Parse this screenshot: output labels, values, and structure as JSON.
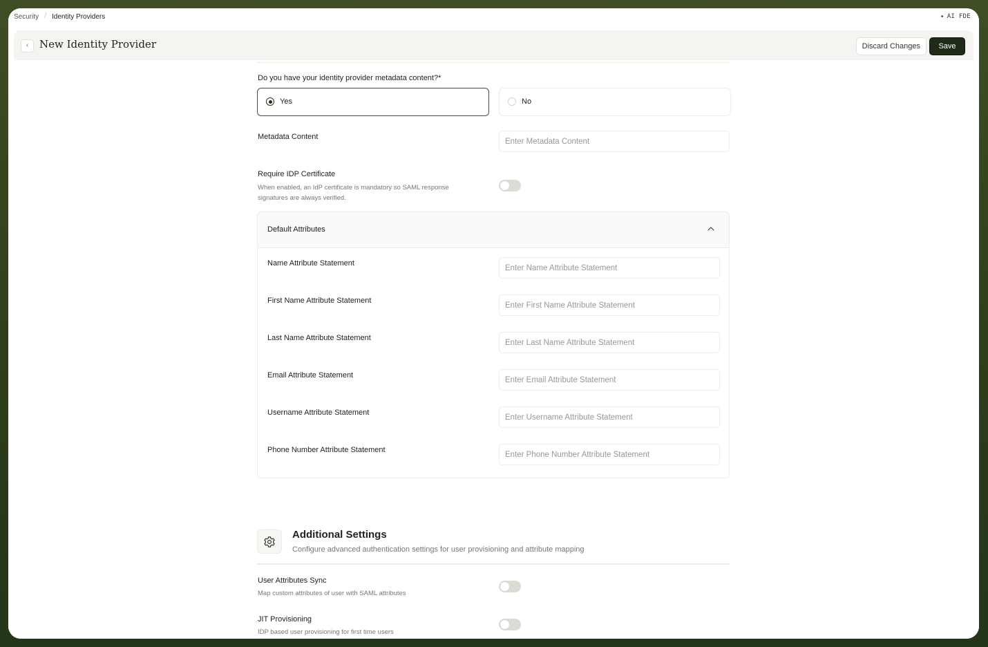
{
  "breadcrumb": {
    "parent": "Security",
    "current": "Identity Providers"
  },
  "top_right": {
    "label": "AI FDE",
    "icon": "sparkle-icon"
  },
  "header": {
    "title": "New Identity Provider",
    "discard_label": "Discard Changes",
    "save_label": "Save"
  },
  "metadata_question": {
    "label": "Do you have your identity provider metadata content?*",
    "options": [
      {
        "label": "Yes",
        "selected": true
      },
      {
        "label": "No",
        "selected": false
      }
    ]
  },
  "metadata_content": {
    "label": "Metadata Content",
    "placeholder": "Enter Metadata Content"
  },
  "require_idp_cert": {
    "label": "Require IDP Certificate",
    "help_line1": "When enabled, an IdP certificate is mandatory so SAML response",
    "help_line2": "signatures are always verified.",
    "enabled": false
  },
  "default_attributes": {
    "title": "Default Attributes",
    "expanded": true,
    "fields": [
      {
        "label": "Name Attribute Statement",
        "placeholder": "Enter Name Attribute Statement"
      },
      {
        "label": "First Name Attribute Statement",
        "placeholder": "Enter First Name Attribute Statement"
      },
      {
        "label": "Last Name Attribute Statement",
        "placeholder": "Enter Last Name Attribute Statement"
      },
      {
        "label": "Email Attribute Statement",
        "placeholder": "Enter Email Attribute Statement"
      },
      {
        "label": "Username Attribute Statement",
        "placeholder": "Enter Username Attribute Statement"
      },
      {
        "label": "Phone Number Attribute Statement",
        "placeholder": "Enter Phone Number Attribute Statement"
      }
    ]
  },
  "additional_settings": {
    "title": "Additional Settings",
    "subtitle": "Configure advanced authentication settings for user provisioning and attribute mapping",
    "icon": "gear-icon",
    "items": [
      {
        "label": "User Attributes Sync",
        "help": "Map custom attributes of user with SAML attributes",
        "enabled": false
      },
      {
        "label": "JIT Provisioning",
        "help": "IDP based user provisioning for first time users",
        "enabled": false
      }
    ]
  },
  "colors": {
    "primary_dark": "#1f2a17",
    "frame_green": "#3f4e24",
    "toggle_off": "#dddbd6"
  }
}
